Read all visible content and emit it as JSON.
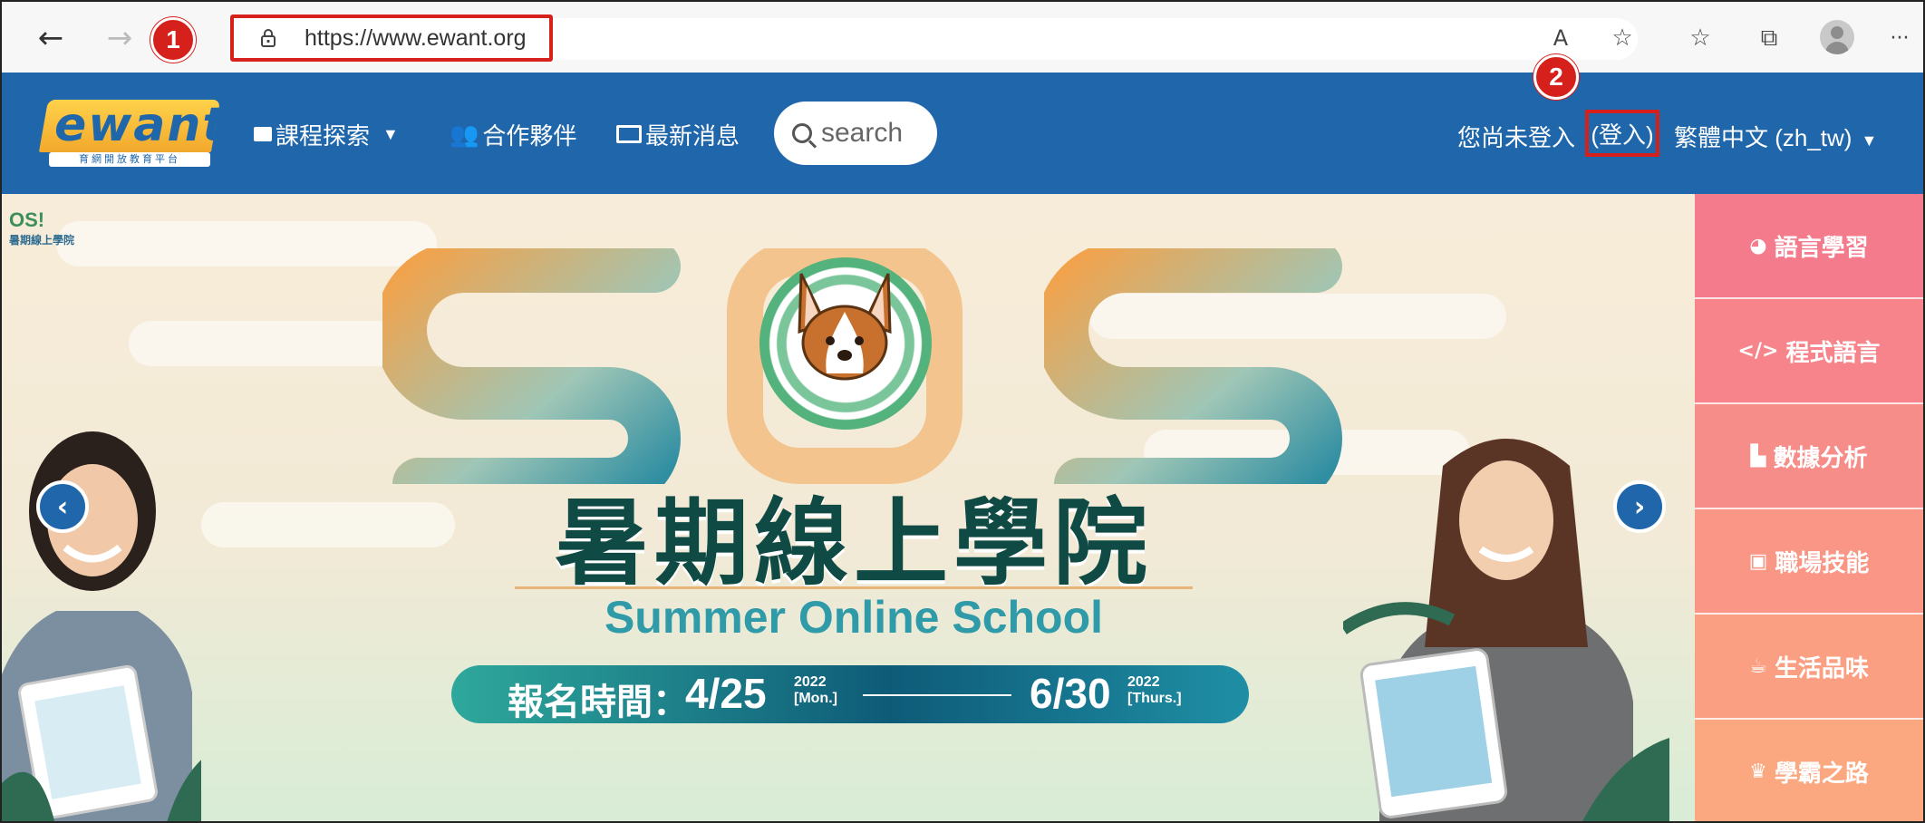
{
  "browser": {
    "url": "https://www.ewant.org",
    "back_icon": "←",
    "forward_icon": "→",
    "read_aloud_icon": "A",
    "favorite_add_icon": "☆",
    "favorites_icon": "☆",
    "collections_icon": "⧉",
    "more_icon": "···"
  },
  "annotations": {
    "badge1": "1",
    "badge2": "2"
  },
  "site": {
    "logo_text": "ewant",
    "logo_sub": "育網開放教育平台",
    "menu": {
      "courses": "課程探索",
      "partners": "合作夥伴",
      "news": "最新消息"
    },
    "search_placeholder": "search",
    "not_logged_in": "您尚未登入",
    "login": "(登入)",
    "language": "繁體中文 (zh_tw)"
  },
  "banner": {
    "corner_logo": "OS!",
    "corner_sub": "暑期線上學院",
    "title_cn": "暑期線上學院",
    "title_en": "Summer Online School",
    "reg_label": "報名時間：",
    "date_start": "4/25",
    "date_start_year": "2022",
    "date_start_day": "[Mon.]",
    "date_end": "6/30",
    "date_end_year": "2022",
    "date_end_day": "[Thurs.]",
    "prev_icon": "‹",
    "next_icon": "›"
  },
  "categories": [
    {
      "icon": "◕",
      "label": "語言學習",
      "color": "#f47b8c"
    },
    {
      "icon": "</>",
      "label": "程式語言",
      "color": "#f6848a"
    },
    {
      "icon": "▙",
      "label": "數據分析",
      "color": "#f78d88"
    },
    {
      "icon": "▣",
      "label": "職場技能",
      "color": "#f99685"
    },
    {
      "icon": "☕",
      "label": "生活品味",
      "color": "#fa9f82"
    },
    {
      "icon": "♛",
      "label": "學霸之路",
      "color": "#fba77f"
    }
  ]
}
